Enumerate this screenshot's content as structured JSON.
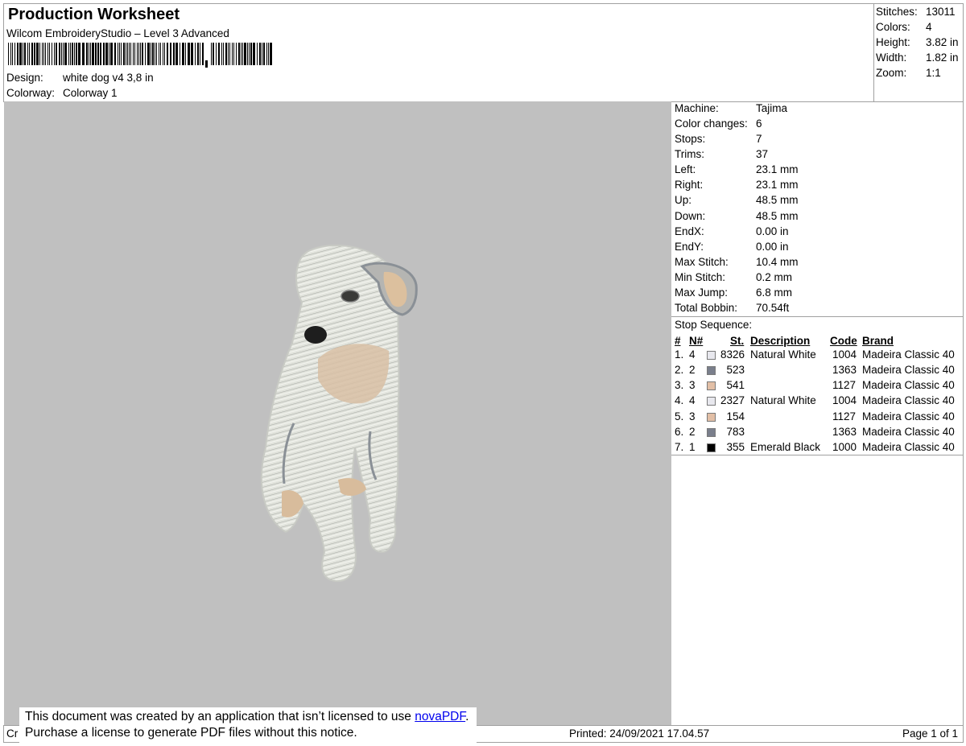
{
  "header": {
    "title": "Production Worksheet",
    "software": "Wilcom EmbroideryStudio – Level 3 Advanced",
    "design_label": "Design:",
    "design_value": "white dog v4  3,8 in",
    "colorway_label": "Colorway:",
    "colorway_value": "Colorway 1"
  },
  "summary": [
    {
      "label": "Stitches:",
      "value": "13011"
    },
    {
      "label": "Colors:",
      "value": "4"
    },
    {
      "label": "Height:",
      "value": "3.82 in"
    },
    {
      "label": "Width:",
      "value": "1.82 in"
    },
    {
      "label": "Zoom:",
      "value": "1:1"
    }
  ],
  "machine_info": [
    {
      "label": "Machine:",
      "value": "Tajima"
    },
    {
      "label": "Color changes:",
      "value": "6"
    },
    {
      "label": "Stops:",
      "value": "7"
    },
    {
      "label": "Trims:",
      "value": "37"
    },
    {
      "label": "Left:",
      "value": "23.1 mm"
    },
    {
      "label": "Right:",
      "value": "23.1 mm"
    },
    {
      "label": "Up:",
      "value": "48.5 mm"
    },
    {
      "label": "Down:",
      "value": "48.5 mm"
    },
    {
      "label": "EndX:",
      "value": "0.00 in"
    },
    {
      "label": "EndY:",
      "value": "0.00 in"
    },
    {
      "label": "Max Stitch:",
      "value": "10.4 mm"
    },
    {
      "label": "Min Stitch:",
      "value": "0.2 mm"
    },
    {
      "label": "Max Jump:",
      "value": "6.8 mm"
    },
    {
      "label": "Total Bobbin:",
      "value": "70.54ft"
    }
  ],
  "stop_sequence": {
    "title": "Stop Sequence:",
    "headers": {
      "num": "#",
      "n": "N#",
      "st": "St.",
      "description": "Description",
      "code": "Code",
      "brand": "Brand"
    },
    "rows": [
      {
        "num": "1.",
        "n": "4",
        "color": "#e8e8ee",
        "st": "8326",
        "description": "Natural White",
        "code": "1004",
        "brand": "Madeira Classic 40"
      },
      {
        "num": "2.",
        "n": "2",
        "color": "#7a7f8c",
        "st": "523",
        "description": "",
        "code": "1363",
        "brand": "Madeira Classic 40"
      },
      {
        "num": "3.",
        "n": "3",
        "color": "#e2bfa6",
        "st": "541",
        "description": "",
        "code": "1127",
        "brand": "Madeira Classic 40"
      },
      {
        "num": "4.",
        "n": "4",
        "color": "#e8e8ee",
        "st": "2327",
        "description": "Natural White",
        "code": "1004",
        "brand": "Madeira Classic 40"
      },
      {
        "num": "5.",
        "n": "3",
        "color": "#e2bfa6",
        "st": "154",
        "description": "",
        "code": "1127",
        "brand": "Madeira Classic 40"
      },
      {
        "num": "6.",
        "n": "2",
        "color": "#7a7f8c",
        "st": "783",
        "description": "",
        "code": "1363",
        "brand": "Madeira Classic 40"
      },
      {
        "num": "7.",
        "n": "1",
        "color": "#000000",
        "st": "355",
        "description": "Emerald Black",
        "code": "1000",
        "brand": "Madeira Classic 40"
      }
    ]
  },
  "notice": {
    "line1_before": "This document was created by an application that isn’t licensed to use ",
    "link": "novaPDF",
    "line1_after": ".",
    "line2": "Purchase a license to generate PDF files without this notice."
  },
  "footer": {
    "left": "Cr",
    "printed": "Printed: 24/09/2021 17.04.57",
    "page": "Page 1 of 1"
  },
  "colors": {
    "canvas": "#c0c0c0",
    "fur_white": "#e4e6e0",
    "fur_grey": "#8a9096",
    "fur_tan": "#d8bc9c"
  }
}
